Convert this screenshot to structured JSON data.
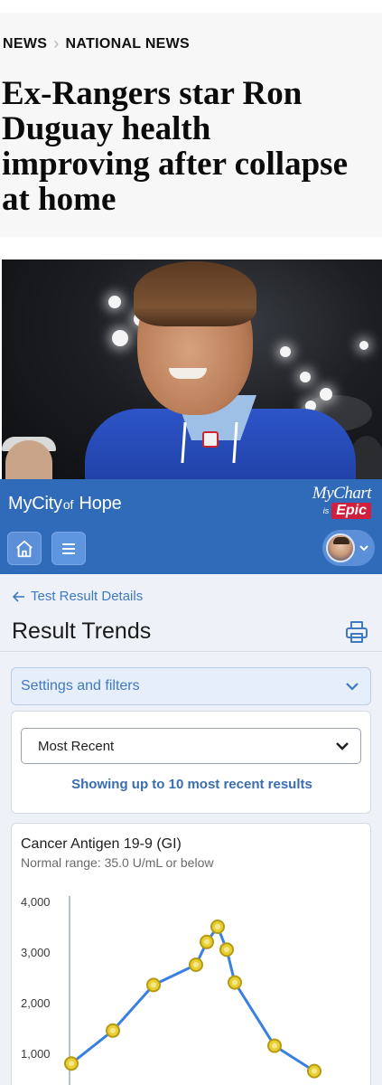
{
  "article": {
    "breadcrumb": [
      "NEWS",
      "NATIONAL NEWS"
    ],
    "headline": "Ex-Rangers star Ron\nDuguay health\nimproving after collapse\nat home",
    "photo_icon": "news-photo-hockey-jersey"
  },
  "app": {
    "brand": {
      "my_city": "MyCity",
      "of": "of",
      "hope": "Hope"
    },
    "mychart": {
      "name": "MyChart",
      "is": "is",
      "epic": "Epic"
    },
    "icons": {
      "home": "home-icon",
      "menu": "menu-icon",
      "avatar": "user-avatar",
      "chevron": "chevron-down-icon",
      "print": "printer-icon",
      "back": "arrow-left-icon"
    },
    "back_link": "Test Result Details",
    "page_title": "Result Trends",
    "settings_label": "Settings and filters",
    "filter": {
      "selected": "Most Recent",
      "note": "Showing up to 10 most recent results"
    },
    "colors": {
      "header": "#2f6bb9",
      "accent": "#3f79c0",
      "line": "#3a80e0",
      "marker": "#e8d033"
    }
  },
  "chart_data": {
    "type": "line",
    "title": "Cancer Antigen 19-9 (GI)",
    "subtitle": "Normal range: 35.0 U/mL or below",
    "ylim": [
      0,
      4000
    ],
    "yticks": [
      "4,000",
      "3,000",
      "2,000",
      "1,000"
    ],
    "ytick_values": [
      4000,
      3000,
      2000,
      1000
    ],
    "series": [
      {
        "values": [
          800,
          1450,
          2350,
          2750,
          3200,
          3500,
          3050,
          2400,
          1150,
          650
        ]
      }
    ]
  }
}
